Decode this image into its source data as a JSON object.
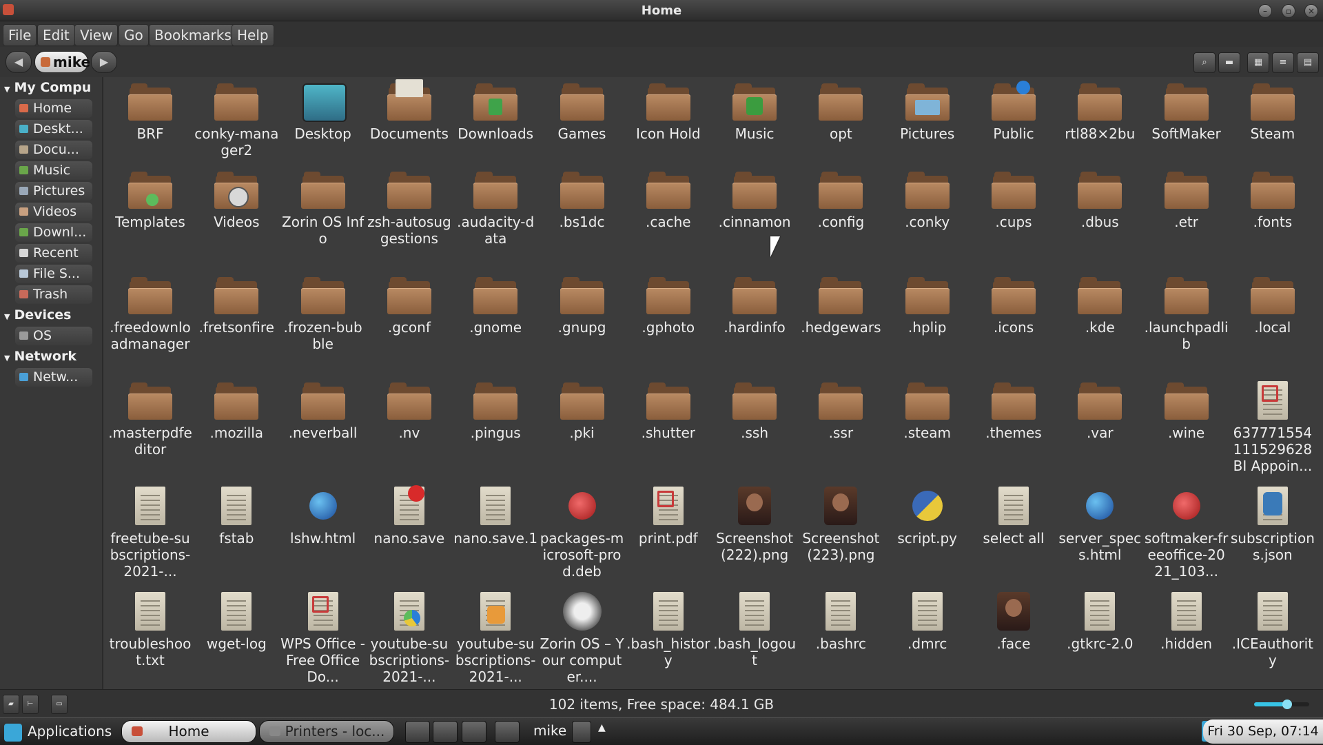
{
  "window": {
    "title": "Home"
  },
  "menu": [
    "File",
    "Edit",
    "View",
    "Go",
    "Bookmarks",
    "Help"
  ],
  "toolbar": {
    "location": "mike",
    "back_glyph": "◀",
    "forward_glyph": "▶"
  },
  "sidebar": {
    "sections": [
      {
        "label": "My Compu",
        "items": [
          {
            "label": "Home",
            "color": "#d96a4a"
          },
          {
            "label": "Deskt...",
            "color": "#4ab0c8"
          },
          {
            "label": "Docu...",
            "color": "#b7a58a"
          },
          {
            "label": "Music",
            "color": "#6aa64a"
          },
          {
            "label": "Pictures",
            "color": "#9aa8b8"
          },
          {
            "label": "Videos",
            "color": "#c8a080"
          },
          {
            "label": "Downl...",
            "color": "#6aa64a"
          },
          {
            "label": "Recent",
            "color": "#d8d8d8"
          },
          {
            "label": "File S...",
            "color": "#b8c8d8"
          },
          {
            "label": "Trash",
            "color": "#c86a5a"
          }
        ]
      },
      {
        "label": "Devices",
        "items": [
          {
            "label": "OS",
            "color": "#9a9a9a"
          }
        ]
      },
      {
        "label": "Network",
        "items": [
          {
            "label": "Netw...",
            "color": "#4aa0d8"
          }
        ]
      }
    ]
  },
  "files": [
    {
      "name": "BRF",
      "kind": "folder"
    },
    {
      "name": "conky-manager2",
      "kind": "folder"
    },
    {
      "name": "Desktop",
      "kind": "desktop"
    },
    {
      "name": "Documents",
      "kind": "folder-docs"
    },
    {
      "name": "Downloads",
      "kind": "folder-downloads"
    },
    {
      "name": "Games",
      "kind": "folder"
    },
    {
      "name": "Icon Hold",
      "kind": "folder"
    },
    {
      "name": "Music",
      "kind": "folder-music"
    },
    {
      "name": "opt",
      "kind": "folder"
    },
    {
      "name": "Pictures",
      "kind": "folder-pictures"
    },
    {
      "name": "Public",
      "kind": "folder-public"
    },
    {
      "name": "rtl88×2bu",
      "kind": "folder"
    },
    {
      "name": "SoftMaker",
      "kind": "folder"
    },
    {
      "name": "Steam",
      "kind": "folder"
    },
    {
      "name": "Templates",
      "kind": "folder-templates"
    },
    {
      "name": "Videos",
      "kind": "folder-videos"
    },
    {
      "name": "Zorin OS Info",
      "kind": "folder"
    },
    {
      "name": "zsh-autosuggestions",
      "kind": "folder"
    },
    {
      "name": ".audacity-data",
      "kind": "folder"
    },
    {
      "name": ".bs1dc",
      "kind": "folder"
    },
    {
      "name": ".cache",
      "kind": "folder"
    },
    {
      "name": ".cinnamon",
      "kind": "folder"
    },
    {
      "name": ".config",
      "kind": "folder"
    },
    {
      "name": ".conky",
      "kind": "folder"
    },
    {
      "name": ".cups",
      "kind": "folder"
    },
    {
      "name": ".dbus",
      "kind": "folder"
    },
    {
      "name": ".etr",
      "kind": "folder"
    },
    {
      "name": ".fonts",
      "kind": "folder"
    },
    {
      "name": ".freedownloadmanager",
      "kind": "folder"
    },
    {
      "name": ".fretsonfire",
      "kind": "folder"
    },
    {
      "name": ".frozen-bubble",
      "kind": "folder"
    },
    {
      "name": ".gconf",
      "kind": "folder"
    },
    {
      "name": ".gnome",
      "kind": "folder"
    },
    {
      "name": ".gnupg",
      "kind": "folder"
    },
    {
      "name": ".gphoto",
      "kind": "folder"
    },
    {
      "name": ".hardinfo",
      "kind": "folder"
    },
    {
      "name": ".hedgewars",
      "kind": "folder"
    },
    {
      "name": ".hplip",
      "kind": "folder"
    },
    {
      "name": ".icons",
      "kind": "folder"
    },
    {
      "name": ".kde",
      "kind": "folder"
    },
    {
      "name": ".launchpadlib",
      "kind": "folder"
    },
    {
      "name": ".local",
      "kind": "folder"
    },
    {
      "name": ".masterpdfeditor",
      "kind": "folder"
    },
    {
      "name": ".mozilla",
      "kind": "folder"
    },
    {
      "name": ".neverball",
      "kind": "folder"
    },
    {
      "name": ".nv",
      "kind": "folder"
    },
    {
      "name": ".pingus",
      "kind": "folder"
    },
    {
      "name": ".pki",
      "kind": "folder"
    },
    {
      "name": ".shutter",
      "kind": "folder"
    },
    {
      "name": ".ssh",
      "kind": "folder"
    },
    {
      "name": ".ssr",
      "kind": "folder"
    },
    {
      "name": ".steam",
      "kind": "folder"
    },
    {
      "name": ".themes",
      "kind": "folder"
    },
    {
      "name": ".var",
      "kind": "folder"
    },
    {
      "name": ".wine",
      "kind": "folder"
    },
    {
      "name": "637771554111529628BI Appoin...",
      "kind": "pdf"
    },
    {
      "name": "freetube-subscriptions-2021-...",
      "kind": "text"
    },
    {
      "name": "fstab",
      "kind": "text"
    },
    {
      "name": "lshw.html",
      "kind": "html"
    },
    {
      "name": "nano.save",
      "kind": "nano"
    },
    {
      "name": "nano.save.1",
      "kind": "text"
    },
    {
      "name": "packages-microsoft-prod.deb",
      "kind": "deb"
    },
    {
      "name": "print.pdf",
      "kind": "pdf"
    },
    {
      "name": "Screenshot (222).png",
      "kind": "image"
    },
    {
      "name": "Screenshot (223).png",
      "kind": "image"
    },
    {
      "name": "script.py",
      "kind": "python"
    },
    {
      "name": "select all",
      "kind": "text"
    },
    {
      "name": "server_specs.html",
      "kind": "html"
    },
    {
      "name": "softmaker-freeoffice-2021_103...",
      "kind": "deb"
    },
    {
      "name": "subscriptions.json",
      "kind": "json"
    },
    {
      "name": "troubleshoot.txt",
      "kind": "text"
    },
    {
      "name": "wget-log",
      "kind": "text"
    },
    {
      "name": "WPS Office - Free Office Do...",
      "kind": "pdf"
    },
    {
      "name": "youtube-subscriptions-2021-...",
      "kind": "chart"
    },
    {
      "name": "youtube-subscriptions-2021-...",
      "kind": "rss"
    },
    {
      "name": "Zorin OS – Your computer....",
      "kind": "video"
    },
    {
      "name": ".bash_history",
      "kind": "text"
    },
    {
      "name": ".bash_logout",
      "kind": "text"
    },
    {
      "name": ".bashrc",
      "kind": "text"
    },
    {
      "name": ".dmrc",
      "kind": "text"
    },
    {
      "name": ".face",
      "kind": "image"
    },
    {
      "name": ".gtkrc-2.0",
      "kind": "text"
    },
    {
      "name": ".hidden",
      "kind": "text"
    },
    {
      "name": ".ICEauthority",
      "kind": "text"
    }
  ],
  "status": {
    "text": "102 items, Free space: 484.1 GB",
    "zoom_fraction": 0.6
  },
  "taskbar": {
    "applications": "Applications",
    "tasks": [
      {
        "label": "Home"
      },
      {
        "label": "Printers - loc..."
      }
    ],
    "user": "mike",
    "clock": "Fri 30 Sep, 07:14"
  }
}
